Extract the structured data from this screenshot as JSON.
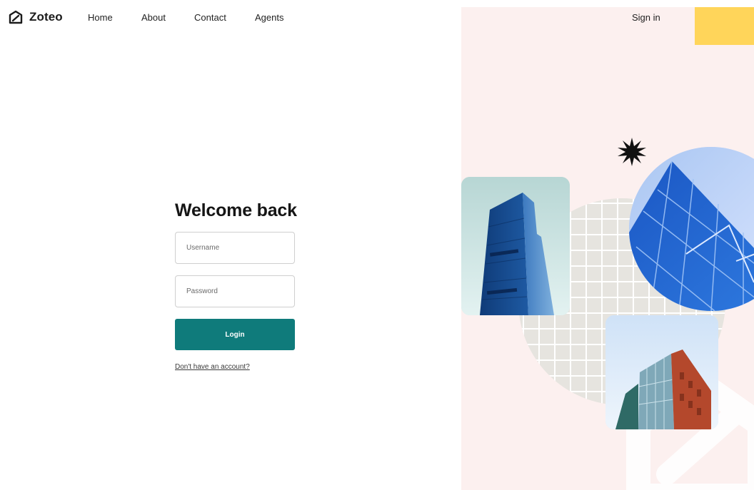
{
  "brand": {
    "name": "Zoteo",
    "logo_icon": "zoteo-logo-icon"
  },
  "nav": {
    "items": [
      {
        "label": "Home"
      },
      {
        "label": "About"
      },
      {
        "label": "Contact"
      },
      {
        "label": "Agents"
      }
    ],
    "sign_in": "Sign in"
  },
  "login": {
    "title": "Welcome back",
    "username_placeholder": "Username",
    "username_value": "",
    "password_placeholder": "Password",
    "password_value": "",
    "submit_label": "Login",
    "signup_link": "Don't have an account?"
  },
  "colors": {
    "accent": "#0f7b7b",
    "panel_bg": "#fcf0ef",
    "highlight": "#ffd55a"
  },
  "decor": {
    "images": [
      "glass-tower-photo",
      "blue-glass-facade-photo",
      "brick-glass-building-photo"
    ],
    "icons": [
      "starburst-icon",
      "house-watermark-icon"
    ]
  }
}
